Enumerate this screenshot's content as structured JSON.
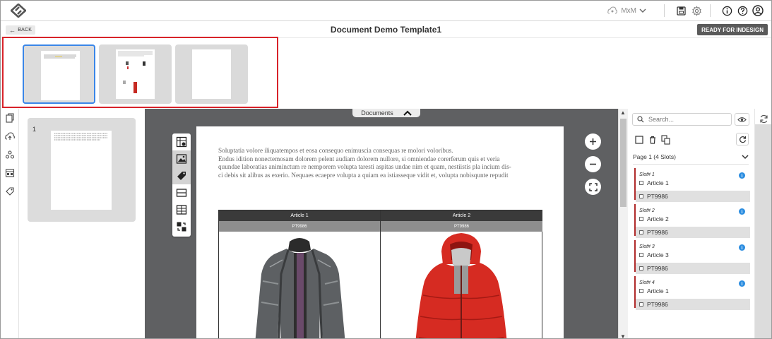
{
  "app": {
    "user": "MxM",
    "back_label": "BACK",
    "title": "Document Demo Template1",
    "ready_label": "READY FOR INDESIGN"
  },
  "thumbnails": [
    {
      "page": 1,
      "selected": true
    },
    {
      "page": 2,
      "selected": false
    },
    {
      "page": 3,
      "selected": false
    }
  ],
  "pages_panel": {
    "page_number": "1"
  },
  "canvas": {
    "documents_tab": "Documents",
    "text_lines": [
      "Soluptatia volore iliquatempos et eosa consequo enimuscia consequas re molori voloribus.",
      "Endus idition nonectemosam dolorem pelent audiam dolorem nullore, si omniendae corerferum quis et veria",
      "quundae laboratias animinctum re nemporem volupta taresti aspitas undae nim et quam, nestiistis pla incium dis-",
      "ci debis sit alibus as exerio. Nequaes ecaepre volupta a quiam ea istiasseque vidit et, volupta nobisqunte repudit"
    ],
    "articles": [
      {
        "name": "Article 1",
        "code": "PT9986"
      },
      {
        "name": "Article 2",
        "code": "PT9986"
      }
    ]
  },
  "slots_panel": {
    "search_placeholder": "Search...",
    "page_group": "Page 1 (4 Slots)",
    "slots": [
      {
        "name": "Slot# 1",
        "article": "Article 1",
        "code": "PT9986"
      },
      {
        "name": "Slot# 2",
        "article": "Article 2",
        "code": "PT9986"
      },
      {
        "name": "Slot# 3",
        "article": "Article 3",
        "code": "PT9986"
      },
      {
        "name": "Slot# 4",
        "article": "Article 1",
        "code": "PT9986"
      }
    ]
  },
  "colors": {
    "highlight_border": "#d8232a",
    "selected_thumb": "#3a86e8",
    "slot_accent": "#b02a2a",
    "info_blue": "#2b8de0",
    "canvas_bg": "#5f6062",
    "jacket_red": "#d62b22",
    "jacket_gray": "#5d6063"
  },
  "icons": {
    "logo": "brand-logo-icon",
    "user_menu": "cloud-user-icon",
    "top": [
      "save-icon",
      "gear-icon",
      "info-icon",
      "help-icon",
      "account-icon"
    ]
  }
}
